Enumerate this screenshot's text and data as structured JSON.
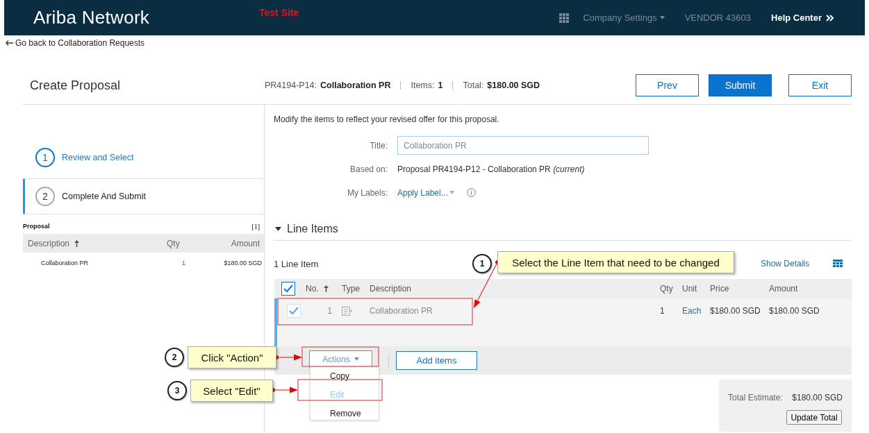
{
  "header": {
    "logo": "Ariba Network",
    "site_label": "Test Site",
    "menu": "Company Settings",
    "vendor": "VENDOR 43603",
    "help": "Help Center"
  },
  "back_link": "Go back to Collaboration Requests",
  "page": {
    "title": "Create Proposal",
    "id": "PR4194-P14:",
    "name": "Collaboration PR",
    "items_label": "Items:",
    "items": "1",
    "total_label": "Total:",
    "total": "$180.00 SGD"
  },
  "buttons": [
    {
      "label": "Prev",
      "primary": false
    },
    {
      "label": "Submit",
      "primary": true
    },
    {
      "label": "Exit",
      "primary": false
    }
  ],
  "steps": [
    {
      "number": "1",
      "label": "Review and Select",
      "selected": false
    },
    {
      "number": "2",
      "label": "Complete And Submit",
      "selected": true
    }
  ],
  "proposal_table": {
    "title": "Proposal",
    "count": "[1]",
    "columns": [
      {
        "label": "Description",
        "sorted": true
      },
      {
        "label": "Qty",
        "sorted": false
      },
      {
        "label": "Amount",
        "sorted": false
      }
    ],
    "rows": [
      [
        "Collaboration PR",
        "1",
        "$180.00 SGD"
      ]
    ]
  },
  "instructions": "Modify the items to reflect your revised offer for this proposal.",
  "form": {
    "title_label": "Title:",
    "title_value": "Collaboration PR",
    "based_on_label": "Based on:",
    "based_on": "Proposal PR4194-P12 - Collaboration PR *(current)*",
    "labels_label": "My Labels:",
    "labels_link": "Apply Label..."
  },
  "line_items": {
    "heading": "Line Items",
    "expanded": true,
    "count": "1 Line Item",
    "show_details": "Show Details",
    "all_checked": true,
    "columns": [
      {
        "label": "No.",
        "sorted": true
      },
      {
        "label": "Type",
        "sorted": false
      },
      {
        "label": "Description",
        "sorted": false
      },
      {
        "label": "Qty",
        "sorted": false
      },
      {
        "label": "Unit",
        "sorted": false
      },
      {
        "label": "Price",
        "sorted": false
      },
      {
        "label": "Amount",
        "sorted": false
      }
    ],
    "rows": [
      {
        "checked": true,
        "no": "1",
        "description": "Collaboration PR",
        "qty": "1",
        "unit": "Each",
        "price": "$180.00 SGD",
        "amount": "$180.00 SGD"
      }
    ],
    "actions": "Actions",
    "add_items": "Add items",
    "menu": [
      {
        "label": "Copy",
        "disabled": false
      },
      {
        "label": "Edit",
        "disabled": true
      },
      {
        "label": "Remove",
        "disabled": false
      }
    ]
  },
  "totals": {
    "label": "Total Estimate:",
    "value": "$180.00 SGD",
    "button": "Update Total"
  },
  "annotations": [
    {
      "number": "1",
      "text": "Select the Line Item that need to be changed"
    },
    {
      "number": "2",
      "text": "Click \"Action\""
    },
    {
      "number": "3",
      "text": "Select \"Edit\""
    }
  ]
}
